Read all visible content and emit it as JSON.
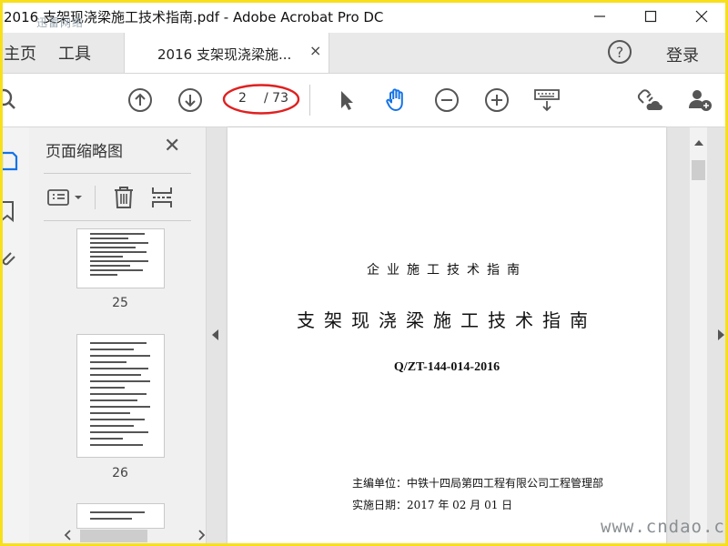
{
  "window": {
    "title": "2016 支架现浇梁施工技术指南.pdf - Adobe Acrobat Pro DC",
    "watermark_top": "迅雷网络",
    "watermark_bottom": "www.cndao.com"
  },
  "tabs": {
    "home": "主页",
    "tools": "工具",
    "document_tab": "2016 支架现浇梁施...",
    "close": "×",
    "help": "?",
    "signin": "登录"
  },
  "toolbar": {
    "current_page": "2",
    "total_pages": "/ 73",
    "accent": "#1473e6",
    "ellipse_color": "#e02020"
  },
  "thumbnails": {
    "title": "页面缩略图",
    "close": "✕",
    "items": [
      {
        "page": "25"
      },
      {
        "page": "26"
      }
    ]
  },
  "document": {
    "org_line": "企业施工技术指南",
    "title": "支架现浇梁施工技术指南",
    "code": "Q/ZT-144-014-2016",
    "editor": "主编单位：中铁十四局第四工程有限公司工程管理部",
    "date": "实施日期：2017 年 02 月 01 日"
  }
}
